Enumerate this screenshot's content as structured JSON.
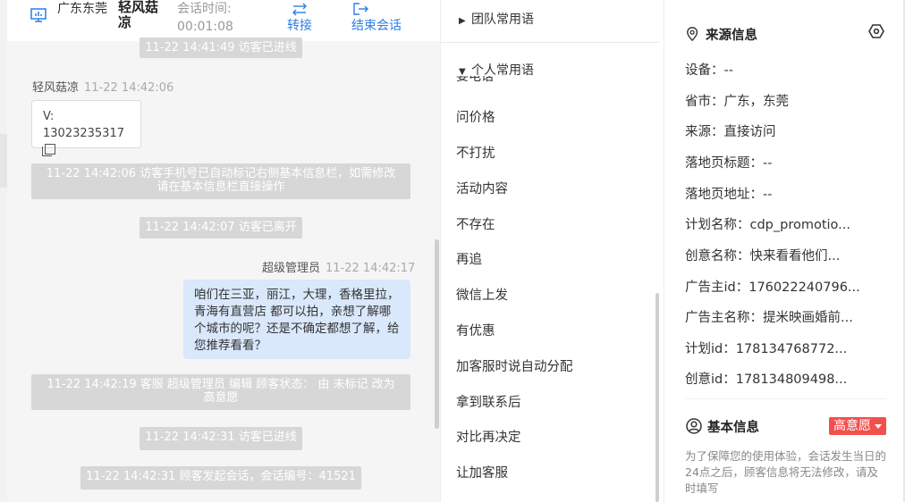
{
  "header": {
    "location": "广东东莞",
    "visitor_name": "轻风菇凉",
    "session_label": "会话时间:",
    "session_time": "00:01:08",
    "transfer_label": "转接",
    "end_label": "结束会话"
  },
  "chat": {
    "sys1": "11-22 14:41:49 访客已进线",
    "visitor_sender": "轻风菇凉",
    "visitor_time": "11-22 14:42:06",
    "card_line1": "V:",
    "card_line2": "13023235317",
    "sys2_line1": "11-22 14:42:06 访客手机号已自动标记右侧基本信息栏，如需修改",
    "sys2_line2": "请在基本信息栏直接操作",
    "sys3": "11-22 14:42:07 访客已离开",
    "agent_sender": "超级管理员",
    "agent_time": "11-22 14:42:17",
    "agent_message": "咱们在三亚，丽江，大理，香格里拉，青海有直营店 都可以拍，亲想了解哪个城市的呢？还是不确定都想了解，给您推荐看看？",
    "sys4_line1": "11-22 14:42:19 客服 超级管理员 编辑 顾客状态： 由 未标记 改为",
    "sys4_line2": "高意愿",
    "sys5": "11-22 14:42:31 访客已进线",
    "sys6": "11-22 14:42:31 顾客发起会话，会话编号：41521"
  },
  "phrases": {
    "team_group": "团队常用语",
    "personal_group": "个人常用语",
    "clipped_top": "要电话",
    "items": [
      "问价格",
      "不打扰",
      "活动内容",
      "不存在",
      "再追",
      "微信上发",
      "有优惠",
      "加客服时说自动分配",
      "拿到联系后",
      "对比再决定",
      "让加客服"
    ]
  },
  "source_info": {
    "title": "来源信息",
    "device": "设备：--",
    "province_city": "省市：广东，东莞",
    "source": "来源：直接访问",
    "landing_title": "落地页标题：--",
    "landing_url": "落地页地址：--",
    "plan_name": "计划名称：cdp_promotio...",
    "creative_name": "创意名称：快来看看他们...",
    "advertiser_id": "广告主id：176022240796...",
    "advertiser_name": "广告主名称：提米映画婚前...",
    "plan_id": "计划id：178134768772...",
    "creative_id": "创意id：178134809498..."
  },
  "basic_info": {
    "title": "基本信息",
    "intent_value": "高意愿",
    "note": "为了保障您的使用体验，会话发生当日的24点之后，顾客信息将无法修改，请及时填写"
  },
  "colors": {
    "accent": "#2b7de9",
    "intent_badge": "#f2504d",
    "agent_bubble": "#d9e8fb",
    "system_message": "#d7d7d7"
  },
  "icons": {
    "monitor": "monitor-icon",
    "transfer": "transfer-arrows-icon",
    "end": "exit-icon",
    "location": "location-pin-icon",
    "settings": "hexagon-settings-icon",
    "user": "user-circle-icon",
    "copy": "copy-icon"
  }
}
